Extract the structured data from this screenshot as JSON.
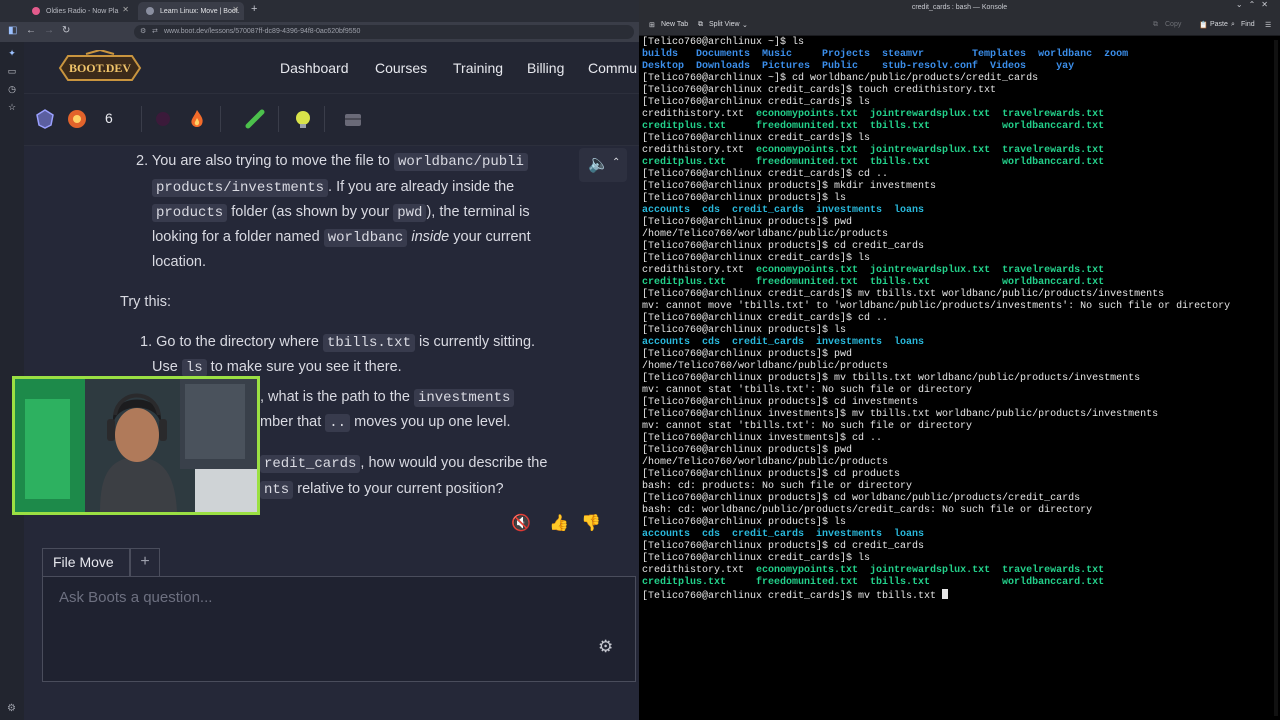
{
  "browser": {
    "tabs": [
      {
        "label": "Oldies Radio - Now Pla"
      },
      {
        "label": "Learn Linux: Move | Boot."
      }
    ],
    "new_tab": "+",
    "url": "www.boot.dev/lessons/570087ff-dc89-4396-94f8-0ac620bf9550"
  },
  "site": {
    "logo_text": "BOOT.DEV",
    "nav": [
      "Dashboard",
      "Courses",
      "Training",
      "Billing",
      "Commu"
    ],
    "streak_count": "6"
  },
  "lesson": {
    "line1_pre": "2. You are also trying to move the file to ",
    "line1_code": "worldbanc/publi",
    "line2_code": "products/investments",
    "line2_post": ". If you are already inside the",
    "line3_code": "products",
    "line3_mid": " folder (as shown by your ",
    "line3_code2": "pwd",
    "line3_post": "), the terminal is",
    "line4_pre": "looking for a folder named ",
    "line4_code": "worldbanc",
    "line4_em": "inside",
    "line4_post": " your current",
    "line5": "location.",
    "try_this": "Try this:",
    "step1_pre": "1. Go to the directory where ",
    "step1_code": "tbills.txt",
    "step1_post": " is currently sitting.",
    "step1b_pre": "Use ",
    "step1b_code": "ls",
    "step1b_post": " to make sure you see it there.",
    "step2_pre": ", what is the path to the ",
    "step2_code": "investments",
    "step2b_pre": "mber that ",
    "step2b_code": "..",
    "step2b_post": " moves you up one level.",
    "step3_code": "redit_cards",
    "step3_post": ", how would you describe the",
    "step3b_code": "nts",
    "step3b_post": " relative to your current position?"
  },
  "chat": {
    "tab_label": "File Move",
    "add_label": "+",
    "placeholder": "Ask Boots a question..."
  },
  "konsole": {
    "title": "credit_cards : bash — Konsole",
    "toolbar": {
      "new_tab": "New Tab",
      "split_view": "Split View",
      "copy": "Copy",
      "paste": "Paste",
      "find": "Find"
    },
    "lines": [
      [
        {
          "t": "[Telico760@archlinux ~]$ ls"
        }
      ],
      [
        {
          "c": "dir",
          "t": "builds   Documents  Music     Projects  steamvr        Templates  worldbanc  zoom"
        }
      ],
      [
        {
          "c": "dir",
          "t": "Desktop  Downloads  Pictures  Public    stub-resolv.conf  Videos     yay"
        }
      ],
      [
        {
          "t": "[Telico760@archlinux ~]$ cd worldbanc/public/products/credit_cards"
        }
      ],
      [
        {
          "t": "[Telico760@archlinux credit_cards]$ touch credithistory.txt"
        }
      ],
      [
        {
          "t": "[Telico760@archlinux credit_cards]$ ls"
        }
      ],
      [
        {
          "t": "credithistory.txt  "
        },
        {
          "c": "file",
          "t": "economypoints.txt  jointrewardsplux.txt  travelrewards.txt"
        }
      ],
      [
        {
          "c": "file",
          "t": "creditplus.txt     freedomunited.txt  tbills.txt            worldbanccard.txt"
        }
      ],
      [
        {
          "t": "[Telico760@archlinux credit_cards]$ ls"
        }
      ],
      [
        {
          "t": "credithistory.txt  "
        },
        {
          "c": "file",
          "t": "economypoints.txt  jointrewardsplux.txt  travelrewards.txt"
        }
      ],
      [
        {
          "c": "file",
          "t": "creditplus.txt     freedomunited.txt  tbills.txt            worldbanccard.txt"
        }
      ],
      [
        {
          "t": "[Telico760@archlinux credit_cards]$ cd .."
        }
      ],
      [
        {
          "t": "[Telico760@archlinux products]$ mkdir investments"
        }
      ],
      [
        {
          "t": "[Telico760@archlinux products]$ ls"
        }
      ],
      [
        {
          "c": "dirb",
          "t": "accounts  cds  credit_cards  investments  loans"
        }
      ],
      [
        {
          "t": "[Telico760@archlinux products]$ pwd"
        }
      ],
      [
        {
          "t": "/home/Telico760/worldbanc/public/products"
        }
      ],
      [
        {
          "t": "[Telico760@archlinux products]$ cd credit_cards"
        }
      ],
      [
        {
          "t": "[Telico760@archlinux credit_cards]$ ls"
        }
      ],
      [
        {
          "t": "credithistory.txt  "
        },
        {
          "c": "file",
          "t": "economypoints.txt  jointrewardsplux.txt  travelrewards.txt"
        }
      ],
      [
        {
          "c": "file",
          "t": "creditplus.txt     freedomunited.txt  tbills.txt            worldbanccard.txt"
        }
      ],
      [
        {
          "t": "[Telico760@archlinux credit_cards]$ mv tbills.txt worldbanc/public/products/investments"
        }
      ],
      [
        {
          "t": "mv: cannot move 'tbills.txt' to 'worldbanc/public/products/investments': No such file or directory"
        }
      ],
      [
        {
          "t": "[Telico760@archlinux credit_cards]$ cd .."
        }
      ],
      [
        {
          "t": "[Telico760@archlinux products]$ ls"
        }
      ],
      [
        {
          "c": "dirb",
          "t": "accounts  cds  credit_cards  investments  loans"
        }
      ],
      [
        {
          "t": "[Telico760@archlinux products]$ pwd"
        }
      ],
      [
        {
          "t": "/home/Telico760/worldbanc/public/products"
        }
      ],
      [
        {
          "t": "[Telico760@archlinux products]$ mv tbills.txt worldbanc/public/products/investments"
        }
      ],
      [
        {
          "t": "mv: cannot stat 'tbills.txt': No such file or directory"
        }
      ],
      [
        {
          "t": "[Telico760@archlinux products]$ cd investments"
        }
      ],
      [
        {
          "t": "[Telico760@archlinux investments]$ mv tbills.txt worldbanc/public/products/investments"
        }
      ],
      [
        {
          "t": "mv: cannot stat 'tbills.txt': No such file or directory"
        }
      ],
      [
        {
          "t": "[Telico760@archlinux investments]$ cd .."
        }
      ],
      [
        {
          "t": "[Telico760@archlinux products]$ pwd"
        }
      ],
      [
        {
          "t": "/home/Telico760/worldbanc/public/products"
        }
      ],
      [
        {
          "t": "[Telico760@archlinux products]$ cd products"
        }
      ],
      [
        {
          "t": "bash: cd: products: No such file or directory"
        }
      ],
      [
        {
          "t": "[Telico760@archlinux products]$ cd worldbanc/public/products/credit_cards"
        }
      ],
      [
        {
          "t": "bash: cd: worldbanc/public/products/credit_cards: No such file or directory"
        }
      ],
      [
        {
          "t": "[Telico760@archlinux products]$ ls"
        }
      ],
      [
        {
          "c": "dirb",
          "t": "accounts  cds  credit_cards  investments  loans"
        }
      ],
      [
        {
          "t": "[Telico760@archlinux products]$ cd credit_cards"
        }
      ],
      [
        {
          "t": "[Telico760@archlinux credit_cards]$ ls"
        }
      ],
      [
        {
          "t": "credithistory.txt  "
        },
        {
          "c": "file",
          "t": "economypoints.txt  jointrewardsplux.txt  travelrewards.txt"
        }
      ],
      [
        {
          "c": "file",
          "t": "creditplus.txt     freedomunited.txt  tbills.txt            worldbanccard.txt"
        }
      ],
      [
        {
          "t": "[Telico760@archlinux credit_cards]$ mv tbills.txt "
        }
      ]
    ]
  }
}
